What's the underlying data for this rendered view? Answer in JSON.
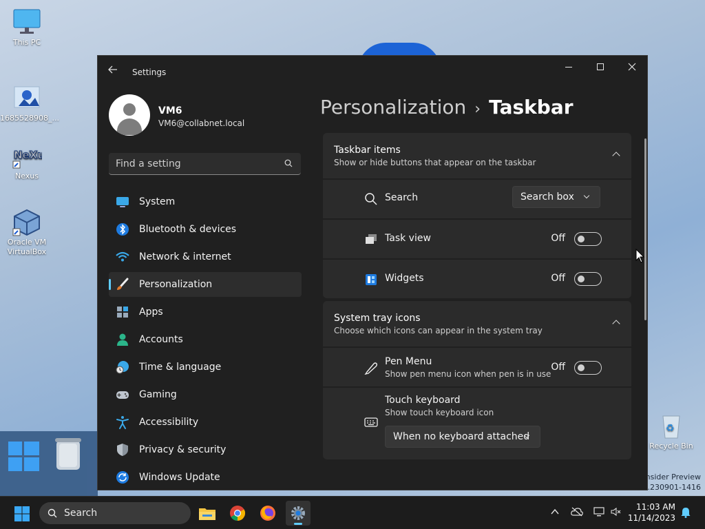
{
  "desktop": {
    "icons": [
      {
        "label": "This PC"
      },
      {
        "label": "1685528908_..."
      },
      {
        "label": "Nexus"
      },
      {
        "label": "Oracle VM VirtualBox"
      },
      {
        "label": "Recycle Bin"
      }
    ],
    "watermark": {
      "line1": "Insider Preview",
      "line2": "se.230901-1416"
    }
  },
  "window": {
    "title": "Settings",
    "profile": {
      "name": "VM6",
      "email": "VM6@collabnet.local"
    },
    "search": {
      "placeholder": "Find a setting"
    },
    "nav": [
      {
        "label": "System",
        "icon": "system-icon"
      },
      {
        "label": "Bluetooth & devices",
        "icon": "bluetooth-icon"
      },
      {
        "label": "Network & internet",
        "icon": "network-icon"
      },
      {
        "label": "Personalization",
        "icon": "personalization-icon",
        "active": true
      },
      {
        "label": "Apps",
        "icon": "apps-icon"
      },
      {
        "label": "Accounts",
        "icon": "accounts-icon"
      },
      {
        "label": "Time & language",
        "icon": "time-language-icon"
      },
      {
        "label": "Gaming",
        "icon": "gaming-icon"
      },
      {
        "label": "Accessibility",
        "icon": "accessibility-icon"
      },
      {
        "label": "Privacy & security",
        "icon": "privacy-icon"
      },
      {
        "label": "Windows Update",
        "icon": "windows-update-icon"
      }
    ],
    "breadcrumb": {
      "parent": "Personalization",
      "separator": "›",
      "current": "Taskbar"
    },
    "taskbar_items": {
      "title": "Taskbar items",
      "subtitle": "Show or hide buttons that appear on the taskbar",
      "search": {
        "label": "Search",
        "value": "Search box"
      },
      "task_view": {
        "label": "Task view",
        "state": "Off"
      },
      "widgets": {
        "label": "Widgets",
        "state": "Off"
      }
    },
    "system_tray": {
      "title": "System tray icons",
      "subtitle": "Choose which icons can appear in the system tray",
      "pen_menu": {
        "label": "Pen Menu",
        "subtitle": "Show pen menu icon when pen is in use",
        "state": "Off"
      },
      "touch_keyboard": {
        "label": "Touch keyboard",
        "subtitle": "Show touch keyboard icon",
        "value": "When no keyboard attached"
      }
    }
  },
  "taskbar": {
    "search_label": "Search",
    "apps": [
      "file-explorer-icon",
      "chrome-icon",
      "firefox-icon",
      "settings-icon"
    ],
    "clock": {
      "time": "11:03 AM",
      "date": "11/14/2023"
    }
  },
  "colors": {
    "accent": "#60cdff",
    "window_bg": "#202020",
    "card_bg": "#2b2b2b"
  }
}
